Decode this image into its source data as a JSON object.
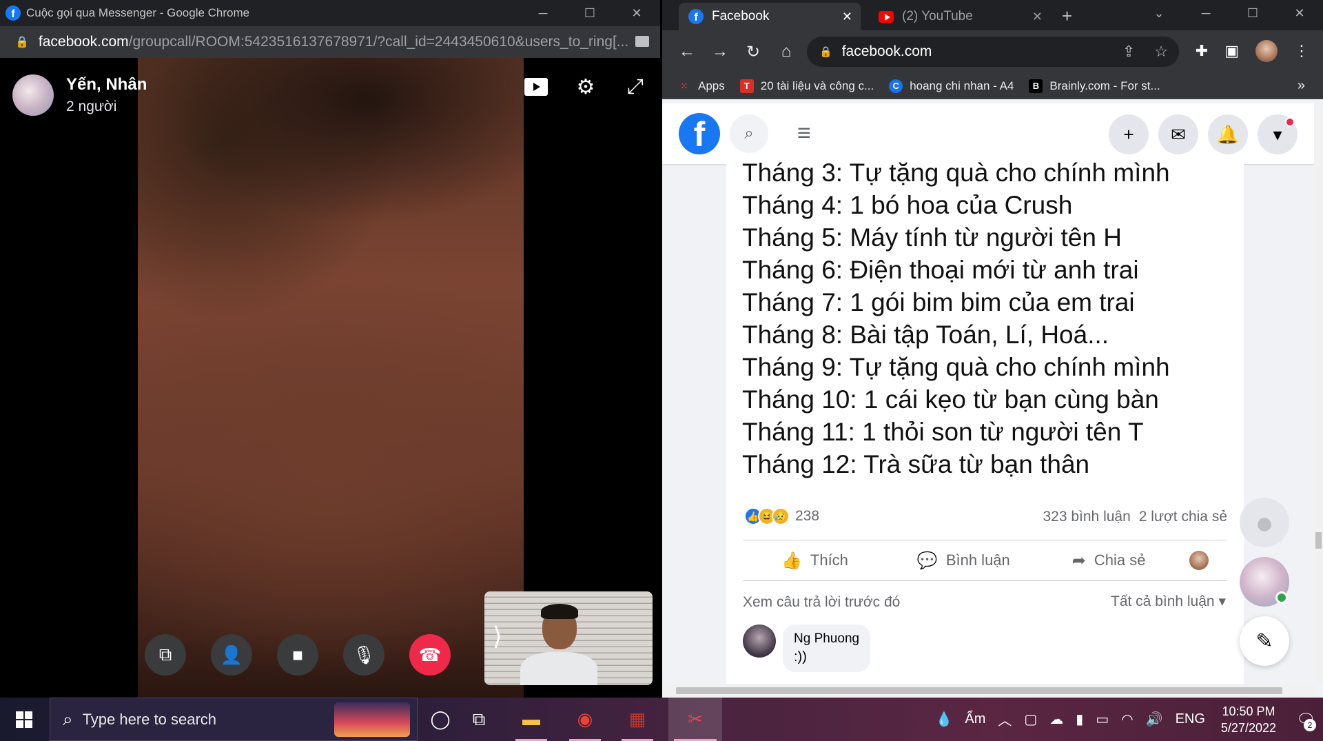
{
  "left_window": {
    "title": "Cuộc gọi qua Messenger - Google Chrome",
    "url_host": "facebook.com",
    "url_path": "/groupcall/ROOM:5423516137678971/?call_id=2443450610&users_to_ring[...",
    "call": {
      "participants": "Yến, Nhân",
      "count": "2 người"
    }
  },
  "right_window": {
    "tabs": [
      {
        "label": "Facebook",
        "icon": "facebook-icon"
      },
      {
        "label": "(2) YouTube",
        "icon": "youtube-icon"
      }
    ],
    "url": "facebook.com",
    "bookmarks": [
      {
        "label": "Apps",
        "icon": "apps-grid-icon",
        "color": "#ea4335"
      },
      {
        "label": "20 tài liệu và công c...",
        "icon": "T",
        "color": "#d93025"
      },
      {
        "label": "hoang chi nhan - A4",
        "icon": "C",
        "color": "#1a73e8"
      },
      {
        "label": "Brainly.com - For st...",
        "icon": "B",
        "color": "#000000"
      }
    ],
    "post": {
      "lines": [
        "Tháng 3: Tự tặng quà cho chính mình",
        "Tháng 4: 1 bó hoa của Crush",
        "Tháng 5: Máy tính từ người tên H",
        "Tháng 6: Điện thoại mới từ anh trai",
        "Tháng 7: 1 gói bim bim của em trai",
        "Tháng 8: Bài tập Toán, Lí, Hoá...",
        "Tháng 9: Tự tặng quà cho chính mình",
        "Tháng 10: 1 cái kẹo từ bạn cùng bàn",
        "Tháng 11: 1 thỏi son từ người tên T",
        "Tháng 12: Trà sữa từ bạn thân"
      ],
      "reaction_count": "238",
      "comments_count": "323 bình luận",
      "shares_count": "2 lượt chia sẻ",
      "actions": {
        "like": "Thích",
        "comment": "Bình luận",
        "share": "Chia sẻ"
      },
      "more_replies": "Xem câu trả lời trước đó",
      "comment_filter": "Tất cả bình luận",
      "comment": {
        "author": "Ng Phuong",
        "text": ":))"
      }
    }
  },
  "taskbar": {
    "search_placeholder": "Type here to search",
    "weather": "Ẩm",
    "language": "ENG",
    "time": "10:50 PM",
    "date": "5/27/2022",
    "notification_count": "2"
  },
  "colors": {
    "facebook_blue": "#1877f2",
    "end_call_red": "#f02849",
    "online_green": "#31a24c"
  }
}
